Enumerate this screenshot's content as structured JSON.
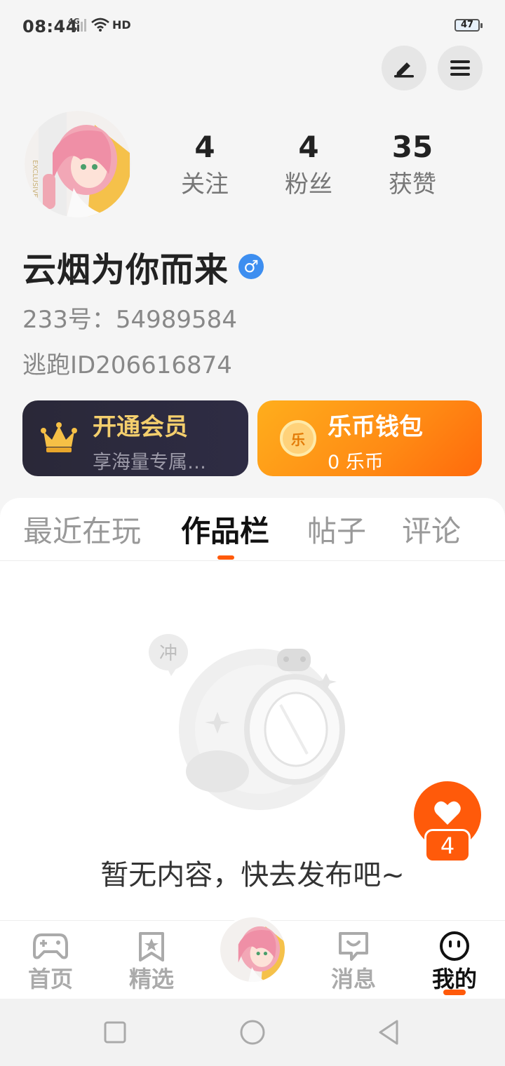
{
  "status_bar": {
    "time": "08:44",
    "network": "4G",
    "hd": "HD",
    "battery": "47"
  },
  "header": {
    "edit_icon": "pen-icon",
    "menu_icon": "hamburger-menu-icon"
  },
  "profile": {
    "avatar_watermark": "EXCLUSIVE",
    "stats": [
      {
        "value": "4",
        "label": "关注"
      },
      {
        "value": "4",
        "label": "粉丝"
      },
      {
        "value": "35",
        "label": "获赞"
      }
    ],
    "nickname": "云烟为你而来",
    "gender_symbol": "♂",
    "id_233": "233号：54989584",
    "id_taopao": "逃跑ID206616874"
  },
  "cards": {
    "vip": {
      "title": "开通会员",
      "subtitle": "享海量专属…"
    },
    "wallet": {
      "title": "乐币钱包",
      "subtitle": "0 乐币",
      "coin_glyph": "乐"
    }
  },
  "tabs": [
    {
      "label": "最近在玩",
      "active": false
    },
    {
      "label": "作品栏",
      "active": true
    },
    {
      "label": "帖子",
      "active": false
    },
    {
      "label": "评论",
      "active": false
    }
  ],
  "empty_state": {
    "bubble_text": "冲",
    "message": "暂无内容，快去发布吧~"
  },
  "like_fab": {
    "count": "4"
  },
  "bottom_nav": [
    {
      "label": "首页",
      "icon": "gamepad-icon",
      "active": false
    },
    {
      "label": "精选",
      "icon": "star-bookmark-icon",
      "active": false
    },
    {
      "label": "消息",
      "icon": "chat-bubble-icon",
      "active": false
    },
    {
      "label": "我的",
      "icon": "smiley-face-icon",
      "active": true
    }
  ],
  "colors": {
    "accent": "#ff5a0a",
    "vip_gold": "#f4cf6d",
    "vip_bg": "#2a2838",
    "wallet_orange": "#ff8a14",
    "gender_blue": "#3d8ef0"
  }
}
